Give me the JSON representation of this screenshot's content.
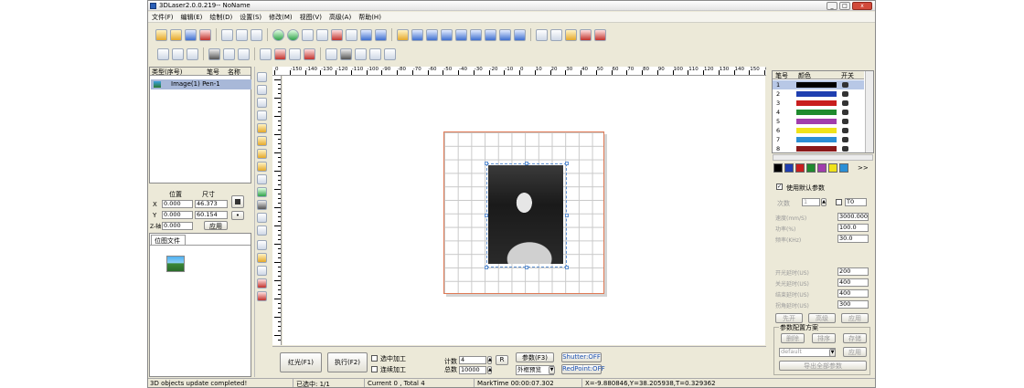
{
  "window": {
    "title": "3DLaser2.0.0.219-- NoName",
    "controls": [
      "_",
      "□",
      "x"
    ]
  },
  "menu": [
    "文件(F)",
    "编辑(E)",
    "绘制(D)",
    "设置(S)",
    "修改(M)",
    "视图(V)",
    "高级(A)",
    "帮助(H)"
  ],
  "object_list": {
    "headers": [
      "类型(序号)",
      "笔号",
      "名称"
    ],
    "items": [
      {
        "label": "Image(1) Pen-1"
      }
    ]
  },
  "position_panel": {
    "pos_header": "位置",
    "size_header": "尺寸",
    "x_label": "X",
    "y_label": "Y",
    "z_label": "Z-轴",
    "x_pos": "0.000",
    "y_pos": "0.000",
    "z_pos": "0.000",
    "x_size": "46.373",
    "y_size": "60.154",
    "apply": "应用"
  },
  "library_tab": "位图文件",
  "ruler_ticks": [
    "0",
    "-150",
    "-140",
    "-130",
    "-120",
    "-110",
    "-100",
    "-90",
    "-80",
    "-70",
    "-60",
    "-50",
    "-40",
    "-30",
    "-20",
    "-10",
    "0",
    "10",
    "20",
    "30",
    "40",
    "50",
    "60",
    "70",
    "80",
    "90",
    "100",
    "110",
    "120",
    "130",
    "140",
    "150",
    "0"
  ],
  "bottom_bar": {
    "red_light": "红光(F1)",
    "execute": "执行(F2)",
    "selected_process": "选中加工",
    "continuous_process": "连续加工",
    "count_label": "计数",
    "count_value": "4",
    "total_label": "总数",
    "total_value": "10000",
    "r_button": "R",
    "params": "参数(F3)",
    "frame_select": "外框预览",
    "shutter": "Shutter:OFF",
    "redpoint": "RedPoint:OFF"
  },
  "pen_table": {
    "headers": [
      "笔号",
      "颜色",
      "开关"
    ],
    "rows": [
      {
        "num": "1",
        "color": "#000000"
      },
      {
        "num": "2",
        "color": "#1f3fb0"
      },
      {
        "num": "3",
        "color": "#c81e1e"
      },
      {
        "num": "4",
        "color": "#1f8a2e"
      },
      {
        "num": "5",
        "color": "#a13dac"
      },
      {
        "num": "6",
        "color": "#f0e21a"
      },
      {
        "num": "7",
        "color": "#2a8fd6"
      },
      {
        "num": "8",
        "color": "#8b1a1a"
      }
    ],
    "palette": [
      "#000000",
      "#1f3fb0",
      "#c81e1e",
      "#1f8a2e",
      "#a13dac",
      "#f0e21a",
      "#2a8fd6"
    ],
    "more": ">>"
  },
  "params_panel": {
    "use_default": "使用默认参数",
    "count_label": "次数",
    "count_value": "1",
    "t_value": "T0",
    "speed_label": "速度(mm/S)",
    "speed_value": "3000.000",
    "power_label": "功率(%)",
    "power_value": "100.0",
    "freq_label": "频率(KHz)",
    "freq_value": "30.0",
    "on_delay_label": "开光延时(US)",
    "on_delay_value": "200",
    "off_delay_label": "关光延时(US)",
    "off_delay_value": "400",
    "end_delay_label": "结束延时(US)",
    "end_delay_value": "400",
    "corner_delay_label": "拐角延时(US)",
    "corner_delay_value": "300",
    "btn_open": "先开",
    "btn_advanced": "高级",
    "btn_apply": "应用",
    "scheme_title": "参数配置方案",
    "btn_delete": "删除",
    "btn_sort": "排序",
    "btn_save": "存储",
    "scheme_value": "default",
    "btn_apply2": "应用",
    "btn_export": "导出全部参数"
  },
  "status": {
    "message": "3D objects update completed!",
    "selection": "已选中: 1/1",
    "counts": "Current 0 , Total 4",
    "marktime": "MarkTime 00:00:07.302",
    "coords": "X=-9.880846,Y=38.205938,T=0.329362"
  }
}
